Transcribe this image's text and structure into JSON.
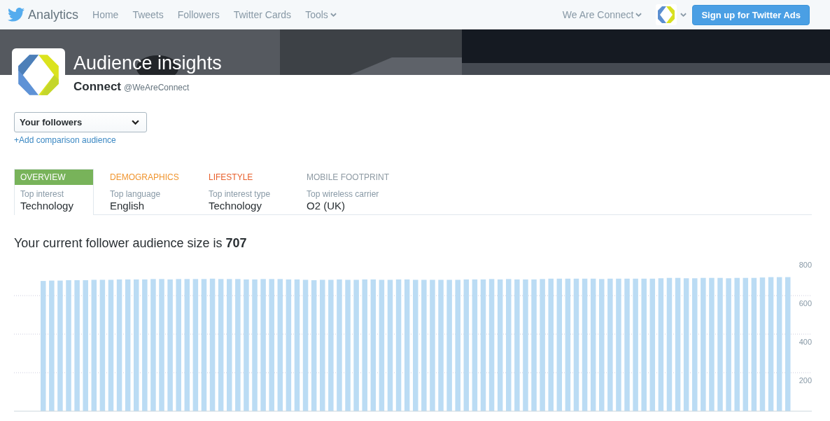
{
  "nav": {
    "brand": "Analytics",
    "links": [
      "Home",
      "Tweets",
      "Followers",
      "Twitter Cards"
    ],
    "tools": "Tools",
    "account": "We Are Connect",
    "cta": "Sign up for Twitter Ads"
  },
  "header": {
    "title": "Audience insights",
    "name": "Connect",
    "handle": "@WeAreConnect"
  },
  "audience": {
    "value": "Your followers",
    "add_link": "+Add comparison audience"
  },
  "tabs": [
    {
      "label": "OVERVIEW",
      "color": "#78b35a",
      "selected": true,
      "metric_label": "Top interest",
      "metric_value": "Technology"
    },
    {
      "label": "DEMOGRAPHICS",
      "color": "#f0952f",
      "selected": false,
      "metric_label": "Top language",
      "metric_value": "English"
    },
    {
      "label": "LIFESTYLE",
      "color": "#e8602c",
      "selected": false,
      "metric_label": "Top interest type",
      "metric_value": "Technology"
    },
    {
      "label": "MOBILE FOOTPRINT",
      "color": "#8e9aa3",
      "selected": false,
      "metric_label": "Top wireless carrier",
      "metric_value": "O2 (UK)"
    }
  ],
  "summary": "Your current follower audience size is **707**",
  "chart_data": {
    "type": "bar",
    "grid": true,
    "ylim": [
      0,
      800
    ],
    "yticks": [
      200,
      400,
      600,
      800
    ],
    "series": [
      {
        "color": "#bbdcf4",
        "values": [
          676,
          678,
          678,
          680,
          680,
          680,
          682,
          682,
          682,
          684,
          684,
          684,
          684,
          686,
          686,
          684,
          686,
          686,
          686,
          686,
          688,
          686,
          686,
          686,
          684,
          684,
          686,
          686,
          686,
          684,
          684,
          682,
          680,
          682,
          682,
          684,
          682,
          682,
          684,
          684,
          682,
          682,
          684,
          684,
          682,
          682,
          682,
          682,
          682,
          682,
          684,
          684,
          684,
          686,
          684,
          686,
          684,
          684,
          684,
          686,
          688,
          688,
          688,
          688,
          688,
          688,
          686,
          688,
          688,
          688,
          688,
          688,
          688,
          690,
          692,
          692,
          690,
          690,
          692,
          692,
          692,
          690,
          692,
          692,
          692,
          694,
          696,
          696,
          696
        ]
      }
    ]
  }
}
